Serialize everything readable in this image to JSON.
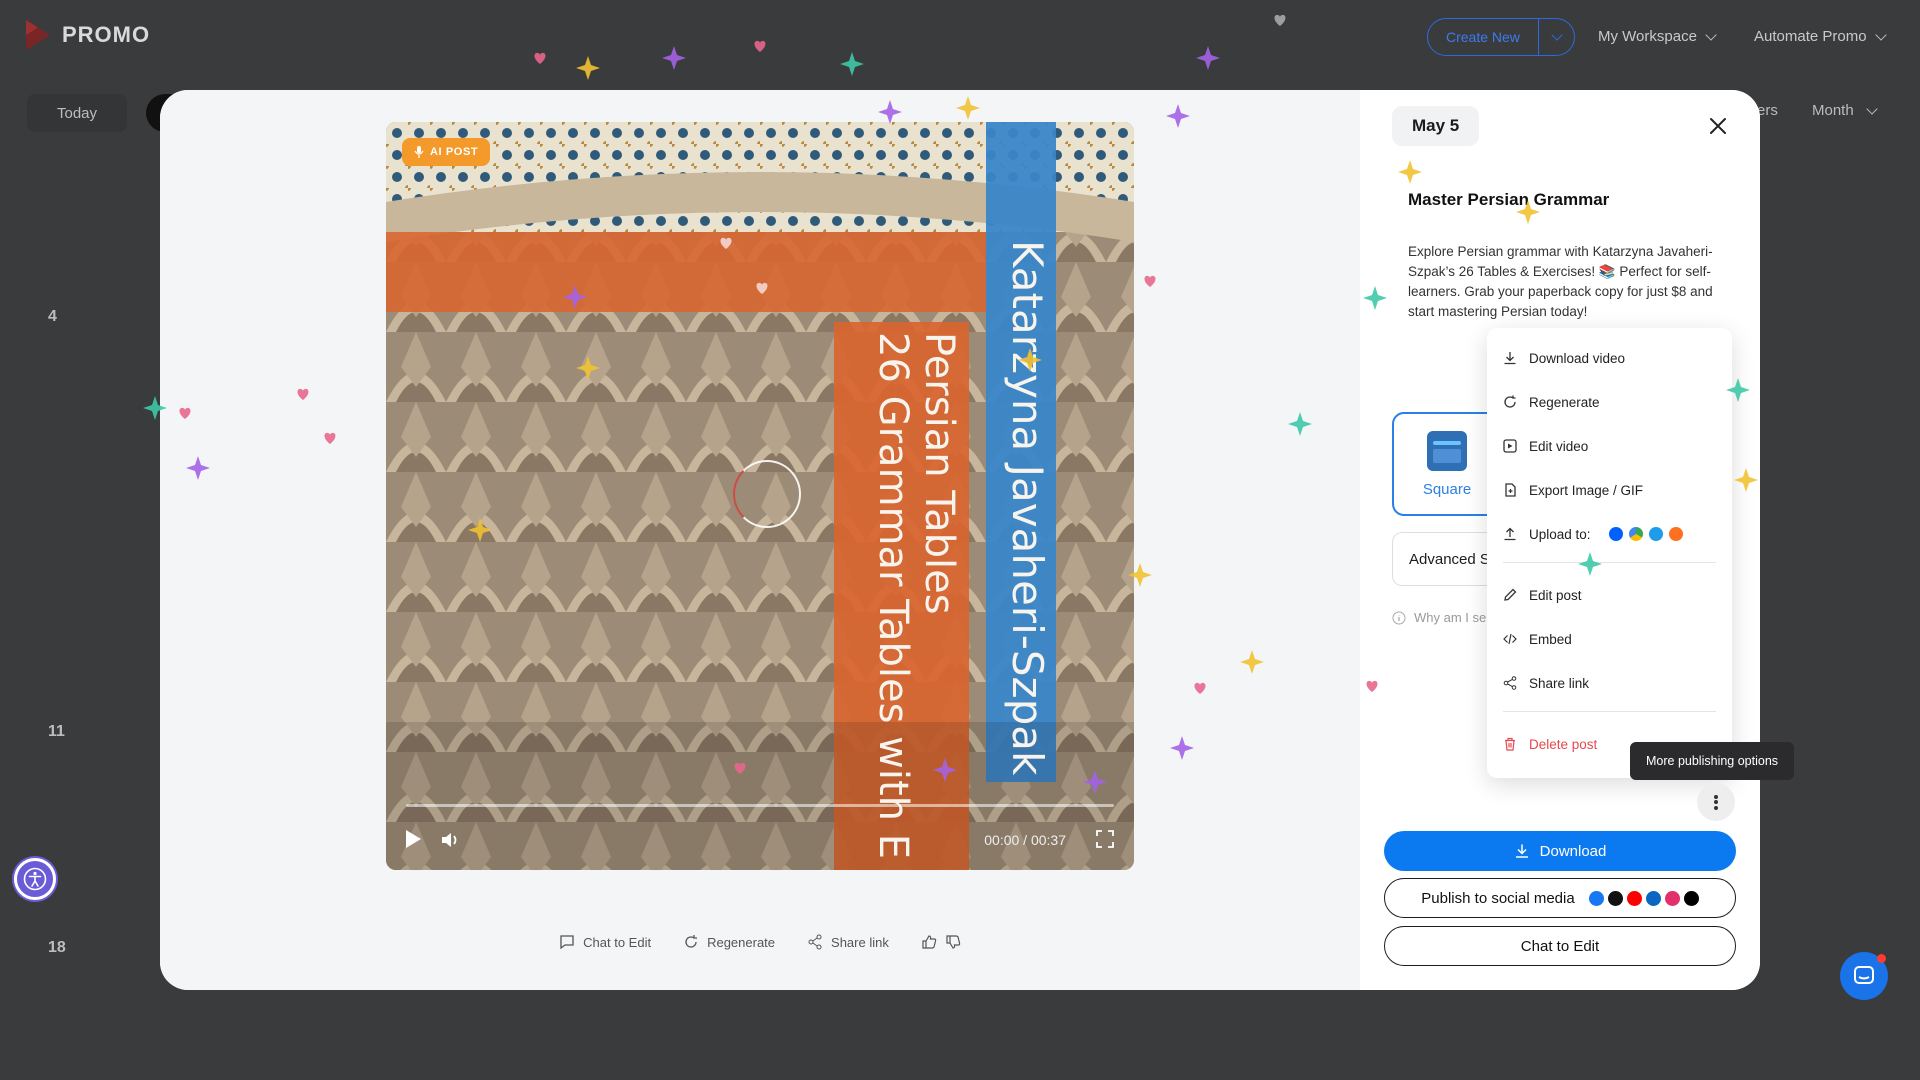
{
  "app": {
    "brand": "PROMO"
  },
  "header": {
    "create_new": "Create New",
    "my_workspace": "My Workspace",
    "automate": "Automate Promo"
  },
  "calendar": {
    "today": "Today",
    "ers_fragment": "ers",
    "view": "Month",
    "day_numbers": [
      "4",
      "11",
      "18"
    ]
  },
  "video": {
    "badge": "AI POST",
    "author_overlay": "Katarzyna Javaheri-Szpak",
    "title_line1": "Persian Tables",
    "title_line2": "26 Grammar Tables with E",
    "time": "00:00 / 00:37"
  },
  "actions": {
    "chat": "Chat to Edit",
    "regenerate": "Regenerate",
    "share": "Share link"
  },
  "post": {
    "date": "May 5",
    "title": "Master Persian Grammar",
    "description": "Explore Persian grammar with Katarzyna Javaheri-Szpak’s 26 Tables & Exercises! 📚 Perfect for self-learners. Grab your paperback copy for just $8 and start mastering Persian today!",
    "format": "Square",
    "advanced": "Advanced S",
    "why": "Why am I se"
  },
  "menu": {
    "download_video": "Download video",
    "regenerate": "Regenerate",
    "edit_video": "Edit video",
    "export": "Export Image / GIF",
    "upload": "Upload to:",
    "edit_post": "Edit post",
    "embed": "Embed",
    "share": "Share link",
    "delete": "Delete post"
  },
  "tooltip": "More publishing options",
  "buttons": {
    "download": "Download",
    "publish": "Publish to social media",
    "chat": "Chat to Edit"
  },
  "colors": {
    "accent": "#0b7af0",
    "badge": "#f39a2a",
    "danger": "#e5484d"
  }
}
